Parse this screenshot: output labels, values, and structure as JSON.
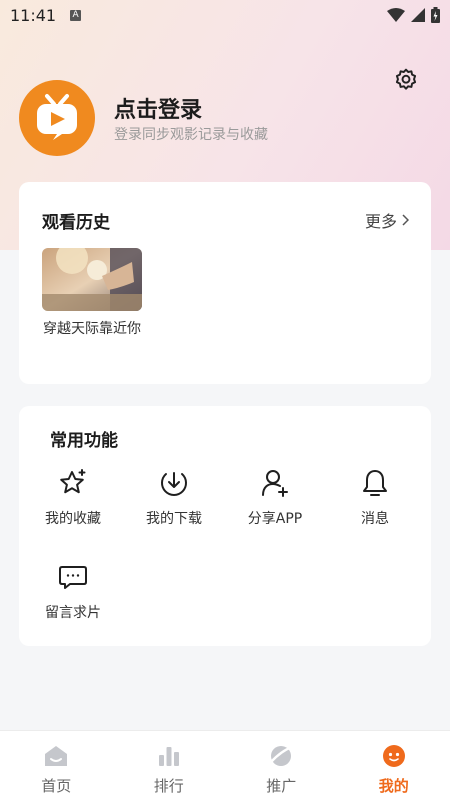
{
  "status_bar": {
    "time": "11:41",
    "notification_badge": "A"
  },
  "profile": {
    "login_title": "点击登录",
    "login_subtitle": "登录同步观影记录与收藏"
  },
  "history": {
    "title": "观看历史",
    "more_label": "更多",
    "items": [
      {
        "title": "穿越天际靠近你"
      }
    ]
  },
  "functions": {
    "title": "常用功能",
    "items": [
      {
        "label": "我的收藏",
        "icon": "star-icon"
      },
      {
        "label": "我的下载",
        "icon": "download-icon"
      },
      {
        "label": "分享APP",
        "icon": "add-user-icon"
      },
      {
        "label": "消息",
        "icon": "bell-icon"
      },
      {
        "label": "留言求片",
        "icon": "message-icon"
      }
    ]
  },
  "tabbar": {
    "tabs": [
      {
        "label": "首页",
        "icon": "home-icon"
      },
      {
        "label": "排行",
        "icon": "ranking-icon"
      },
      {
        "label": "推广",
        "icon": "promote-icon"
      },
      {
        "label": "我的",
        "icon": "profile-icon",
        "active": true
      }
    ]
  },
  "colors": {
    "accent": "#ef6a1c",
    "avatar_orange": "#f08a1f"
  }
}
